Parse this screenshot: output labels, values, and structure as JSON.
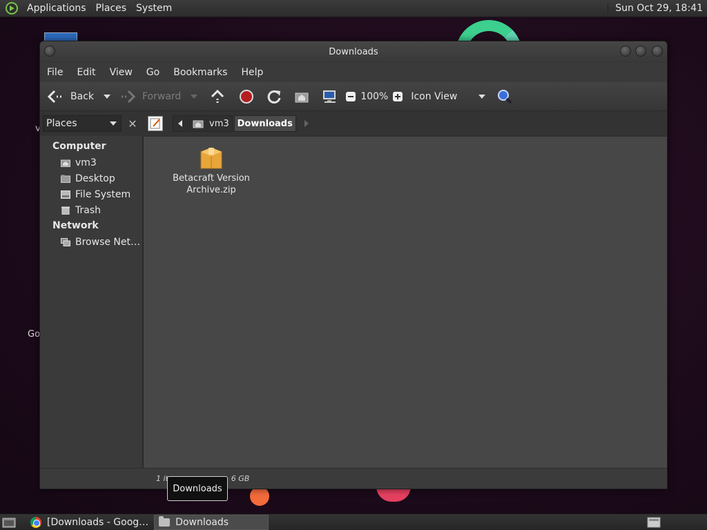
{
  "top_panel": {
    "menus": [
      "Applications",
      "Places",
      "System"
    ],
    "clock": "Sun Oct 29, 18:41"
  },
  "desktop": {
    "partial_texts": [
      "v",
      "Go"
    ]
  },
  "window": {
    "title": "Downloads",
    "menubar": [
      "File",
      "Edit",
      "View",
      "Go",
      "Bookmarks",
      "Help"
    ],
    "toolbar": {
      "back_label": "Back",
      "forward_label": "Forward",
      "zoom_level": "100%",
      "view_mode": "Icon View"
    },
    "side_pane": {
      "selector": "Places",
      "sections": [
        {
          "heading": "Computer",
          "items": [
            {
              "label": "vm3",
              "icon": "home-icon"
            },
            {
              "label": "Desktop",
              "icon": "folder-icon"
            },
            {
              "label": "File System",
              "icon": "drive-icon"
            },
            {
              "label": "Trash",
              "icon": "trash-icon"
            }
          ]
        },
        {
          "heading": "Network",
          "items": [
            {
              "label": "Browse Net…",
              "icon": "network-icon"
            }
          ]
        }
      ]
    },
    "breadcrumbs": [
      "vm3",
      "Downloads"
    ],
    "files": [
      {
        "name": "Betacraft Version Archive.zip",
        "icon": "archive-icon"
      }
    ],
    "status": "1 it                          6 GB"
  },
  "tooltip": "Downloads",
  "taskbar": {
    "tasks": [
      {
        "label": "[Downloads - Goog…",
        "icon": "chrome-icon"
      },
      {
        "label": "Downloads",
        "icon": "folder-icon"
      }
    ]
  }
}
